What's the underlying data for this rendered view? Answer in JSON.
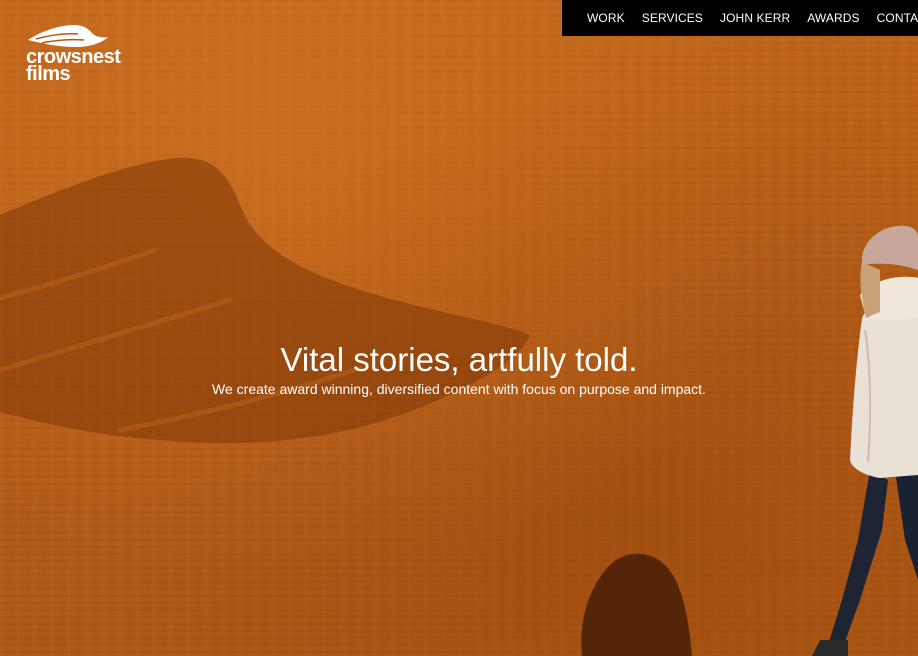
{
  "brand": {
    "logo_line1": "crowsnest",
    "logo_line2": "films",
    "logo_icon": "wing-icon"
  },
  "nav": {
    "items": [
      {
        "label": "WORK"
      },
      {
        "label": "SERVICES"
      },
      {
        "label": "JOHN KERR"
      },
      {
        "label": "AWARDS"
      },
      {
        "label": "CONTACT"
      }
    ]
  },
  "hero": {
    "headline": "Vital stories, artfully told.",
    "subline": "We create award winning, diversified content with focus on purpose and impact.",
    "background_image": "orange-wall-with-walking-person",
    "watermark_icon": "wing-watermark-icon"
  },
  "colors": {
    "background": "#b65a14",
    "nav_background": "#000000",
    "text": "#ffffff",
    "watermark": "#8a3e0b"
  }
}
